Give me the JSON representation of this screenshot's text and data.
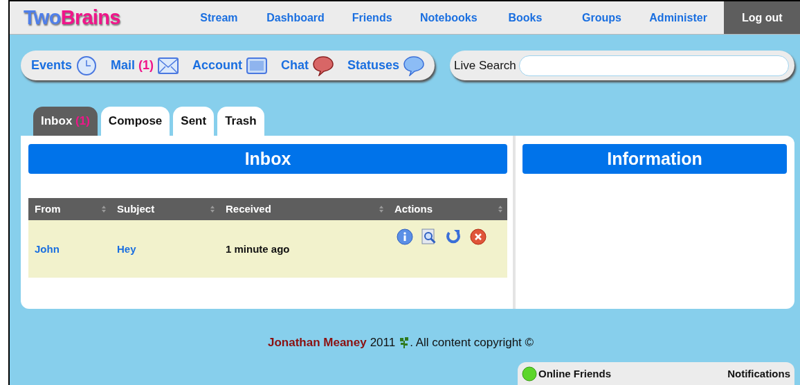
{
  "logo": {
    "part1": "Two",
    "part2": "Brains"
  },
  "nav": [
    {
      "label": "Stream"
    },
    {
      "label": "Dashboard"
    },
    {
      "label": "Friends"
    },
    {
      "label": "Notebooks"
    },
    {
      "label": "Books"
    },
    {
      "label": "Groups"
    },
    {
      "label": "Administer"
    },
    {
      "label": "Log out",
      "kind": "logout"
    }
  ],
  "quick_links": [
    {
      "label": "Events"
    },
    {
      "label": "Mail",
      "count": "(1)"
    },
    {
      "label": "Account"
    },
    {
      "label": "Chat"
    },
    {
      "label": "Statuses"
    }
  ],
  "live_search": {
    "label": "Live Search"
  },
  "tabs": [
    {
      "label": "Inbox",
      "count": "(1)",
      "selected": true
    },
    {
      "label": "Compose",
      "selected": false
    },
    {
      "label": "Sent",
      "selected": false
    },
    {
      "label": "Trash",
      "selected": false
    }
  ],
  "inbox": {
    "title": "Inbox",
    "columns": [
      "From",
      "Subject",
      "Received",
      "Actions"
    ],
    "rows": [
      {
        "from": "John",
        "subject": "Hey",
        "received": "1 minute ago"
      }
    ]
  },
  "information": {
    "title": "Information"
  },
  "footer": {
    "author": "Jonathan Meaney",
    "year": "2011",
    "text": ". All content copyright ©"
  },
  "bottom_panel": {
    "online_friends": "Online Friends",
    "notifications": "Notifications"
  }
}
